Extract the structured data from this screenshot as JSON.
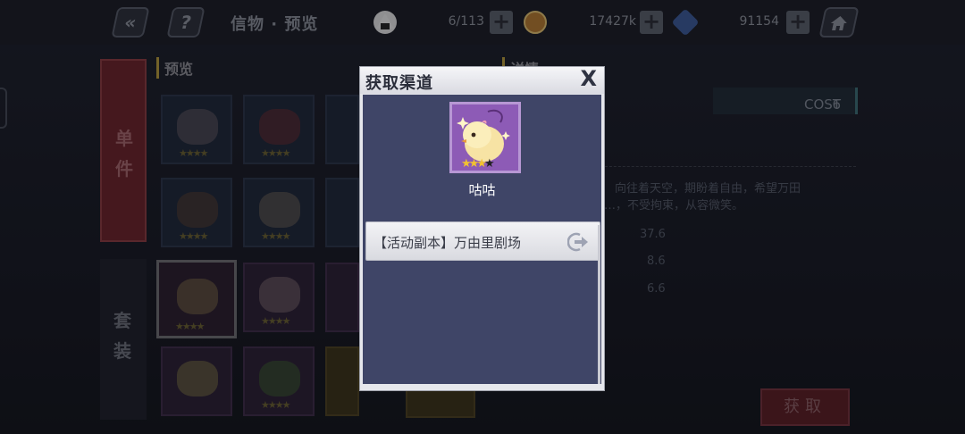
{
  "topbar": {
    "title": "信物 · 预览",
    "resources": [
      {
        "name": "rice-ball",
        "value": "6/113"
      },
      {
        "name": "coin",
        "value": "17427k"
      },
      {
        "name": "crystal",
        "value": "91154"
      }
    ],
    "back_icon": "double-chevron-left",
    "help_icon": "question-mark",
    "home_icon": "house"
  },
  "tabs": {
    "single": "单件",
    "set": "套装"
  },
  "panels": {
    "preview": "预览",
    "detail": "详情"
  },
  "detail": {
    "cost_label": "COST",
    "cost_value": "6",
    "desc_line1": "向往着天空，期盼着自由，希望万田",
    "desc_line2": "…，不受拘束，从容微笑。",
    "stats": [
      "37.6",
      "8.6",
      "6.6"
    ]
  },
  "get_button": "获取",
  "modal": {
    "title": "获取渠道",
    "close": "X",
    "item_name": "咕咕",
    "item_stars": 3,
    "item_max_stars": 4,
    "sources": [
      {
        "label": "【活动副本】万由里剧场"
      }
    ]
  },
  "colors": {
    "modal_body": "#3f4567",
    "item_bg": "#8d5bb6",
    "accent_red": "#6b2229",
    "star_gold": "#f2c230"
  }
}
